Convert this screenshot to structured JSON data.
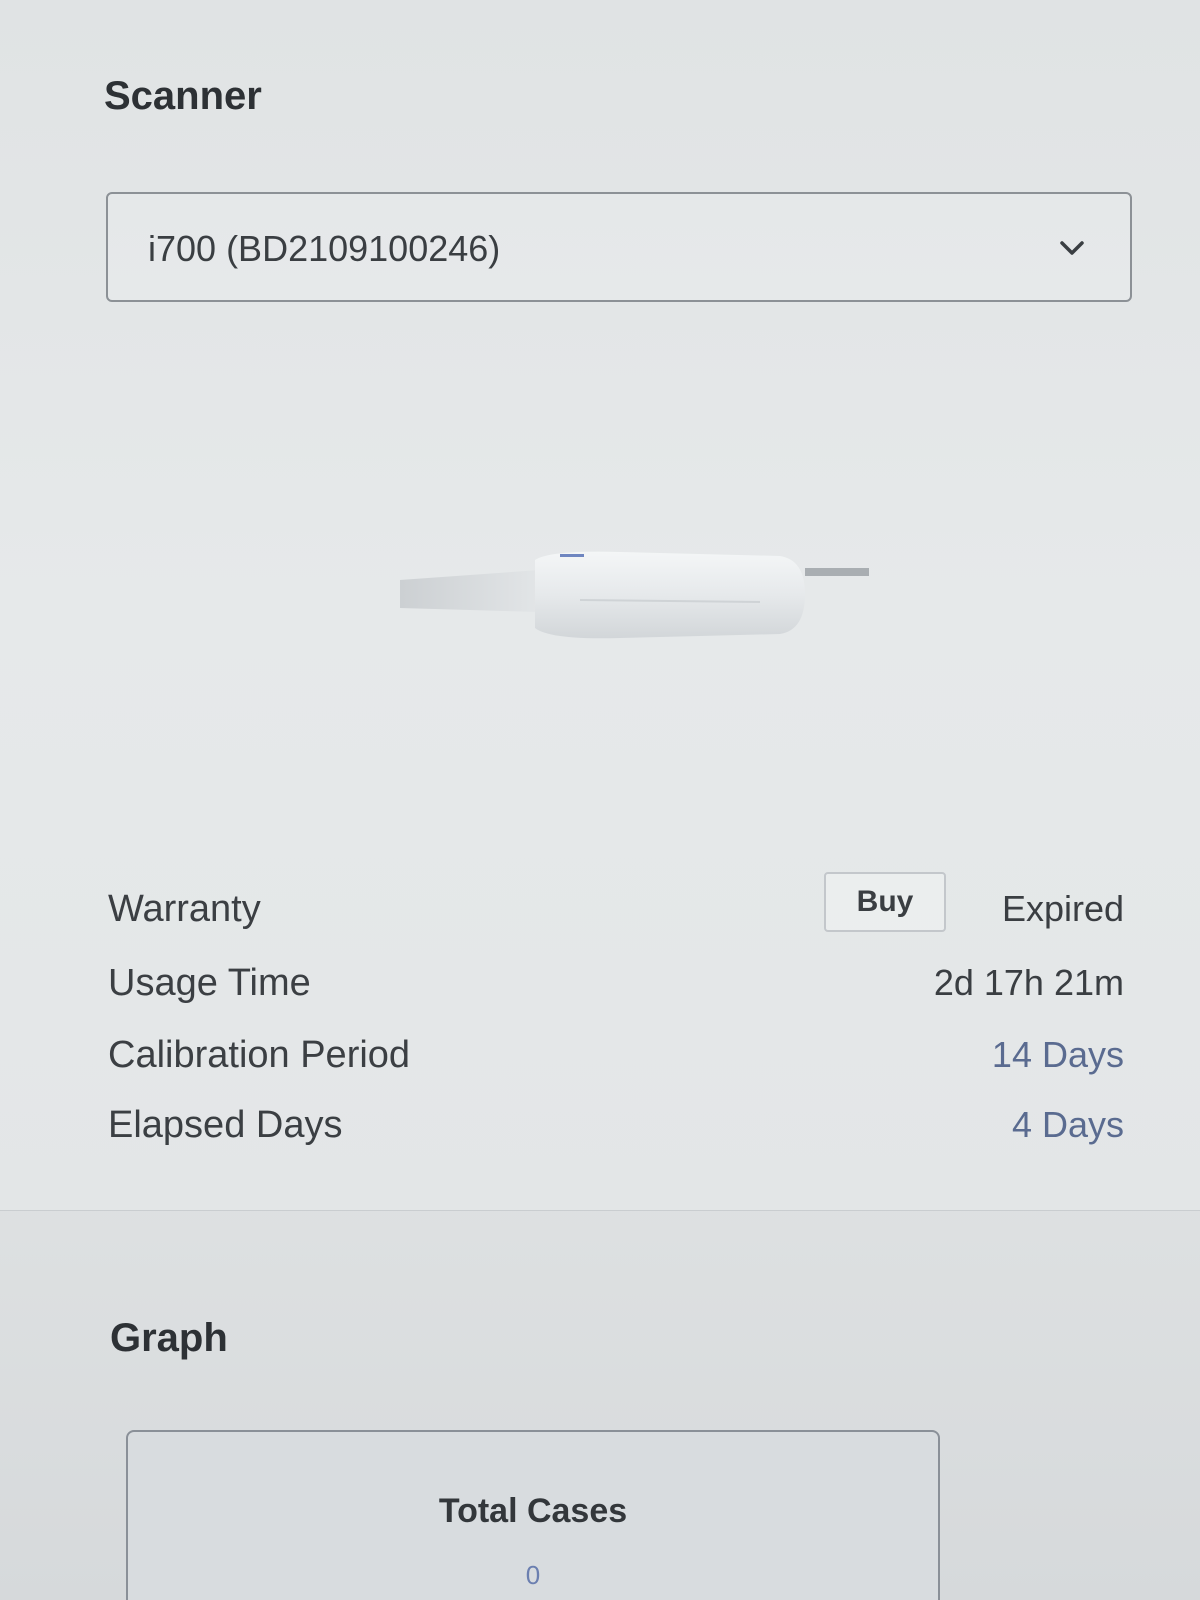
{
  "scanner": {
    "title": "Scanner",
    "selected_device": "i700 (BD2109100246)",
    "chevron_icon": "chevron-down-icon"
  },
  "device_image": {
    "icon": "intraoral-scanner-image"
  },
  "info": {
    "warranty_label": "Warranty",
    "buy_label": "Buy",
    "warranty_value": "Expired",
    "usage_time_label": "Usage Time",
    "usage_time_value": "2d 17h 21m",
    "calibration_period_label": "Calibration Period",
    "calibration_period_value": "14 Days",
    "elapsed_days_label": "Elapsed Days",
    "elapsed_days_value": "4 Days"
  },
  "graph": {
    "title": "Graph",
    "total_cases_label": "Total Cases",
    "total_cases_value": "0"
  },
  "colors": {
    "accent_value": "#5a6b90",
    "stat_value": "#6b7fb0"
  }
}
